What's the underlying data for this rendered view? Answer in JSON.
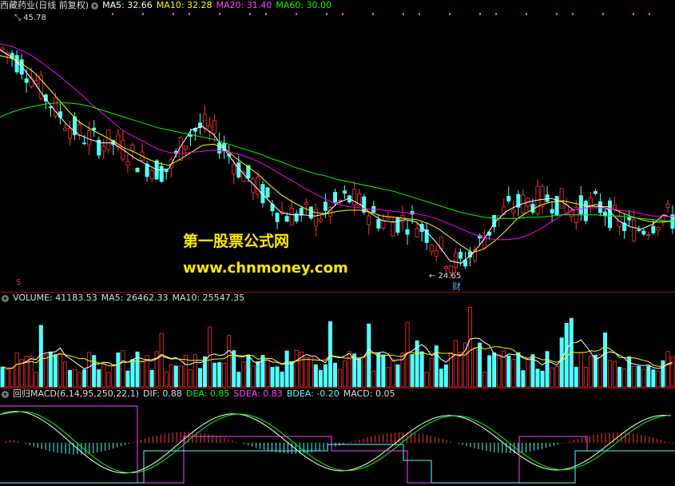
{
  "price_header": {
    "title": "西藏药业(日线 前复权)",
    "ma5": "MA5: 32.66",
    "ma10": "MA10: 32.28",
    "ma20": "MA20: 31.40",
    "ma60": "MA60: 30.00"
  },
  "annotations": {
    "high": "45.78",
    "low": "24.65",
    "cai_marker": "财",
    "s_marker": "S"
  },
  "watermark": {
    "line1": "第一股票公式网",
    "line2": "www.chnmoney.com"
  },
  "volume_header": {
    "volume": "VOLUME: 41183.53",
    "ma5": "MA5: 26462.33",
    "ma10": "MA10: 25547.35"
  },
  "macd_header": {
    "name": "回归MACD(6,14,95,250,22,1)",
    "dif": "DIF: 0.88",
    "dea": "DEA: 0.85",
    "sdea": "SDEA: 0.83",
    "bdea": "BDEA: -0.20",
    "macd": "MACD: 0.05"
  },
  "colors": {
    "up": "#ff3232",
    "down": "#54ffff",
    "ma5": "#ffffff",
    "ma10": "#ffff00",
    "ma20": "#ff00ff",
    "ma60": "#00ff00",
    "background": "#000000"
  },
  "chart_data": {
    "type": "line",
    "ylim": [
      24.0,
      46.5
    ],
    "series": [
      {
        "name": "MA5",
        "values": [
          43.5,
          42.9,
          42.0,
          40.8,
          39.4,
          38.2,
          37.1,
          36.3,
          35.9,
          35.6,
          35.6,
          35.0,
          34.3,
          33.8,
          33.3,
          33.4,
          35.2,
          36.7,
          37.0,
          36.3,
          35.0,
          33.7,
          32.6,
          31.6,
          30.6,
          29.7,
          29.5,
          29.5,
          29.4,
          29.6,
          30.5,
          30.9,
          30.4,
          29.6,
          29.0,
          28.9,
          29.1,
          28.9,
          28.0,
          26.9,
          25.6,
          25.4,
          26.2,
          27.4,
          28.9,
          29.8,
          30.3,
          30.6,
          30.8,
          30.9,
          30.6,
          29.9,
          30.1,
          30.4,
          30.0,
          29.0,
          28.5,
          28.3,
          28.7,
          29.5,
          29.2
        ]
      },
      {
        "name": "MA10",
        "values": [
          43.0,
          42.8,
          42.3,
          41.6,
          40.6,
          39.5,
          38.4,
          37.4,
          36.8,
          36.3,
          35.8,
          35.2,
          34.8,
          34.3,
          33.9,
          33.7,
          34.2,
          34.8,
          35.4,
          35.5,
          35.1,
          34.3,
          33.6,
          32.9,
          32.0,
          31.2,
          30.6,
          30.1,
          29.7,
          29.6,
          29.8,
          29.9,
          29.9,
          29.7,
          29.4,
          29.3,
          29.2,
          29.1,
          28.8,
          28.3,
          27.6,
          26.9,
          26.3,
          26.6,
          27.3,
          28.2,
          29.2,
          29.8,
          30.3,
          30.6,
          30.7,
          30.5,
          30.3,
          30.2,
          30.2,
          29.8,
          29.4,
          29.1,
          28.9,
          28.9,
          29.0
        ]
      },
      {
        "name": "MA20",
        "values": [
          44.0,
          43.8,
          43.4,
          42.9,
          42.2,
          41.5,
          40.7,
          39.9,
          39.0,
          38.2,
          37.4,
          36.6,
          36.1,
          35.6,
          35.1,
          34.8,
          34.7,
          34.8,
          34.9,
          35.0,
          34.9,
          34.7,
          34.4,
          34.0,
          33.5,
          32.9,
          32.4,
          31.8,
          31.3,
          30.8,
          30.4,
          30.2,
          30.1,
          30.0,
          29.9,
          29.8,
          29.7,
          29.6,
          29.4,
          29.1,
          28.7,
          28.3,
          27.9,
          27.6,
          27.4,
          27.4,
          27.5,
          27.8,
          28.3,
          28.9,
          29.5,
          29.9,
          30.1,
          30.1,
          30.1,
          29.9,
          29.8,
          29.6,
          29.4,
          29.4,
          29.3
        ]
      },
      {
        "name": "MA60",
        "values": [
          37.8,
          38.2,
          38.5,
          38.7,
          38.9,
          39.0,
          39.0,
          38.9,
          38.7,
          38.4,
          38.1,
          37.8,
          37.5,
          37.2,
          36.9,
          36.7,
          36.5,
          36.3,
          36.1,
          35.9,
          35.6,
          35.3,
          35.0,
          34.7,
          34.3,
          34.0,
          33.6,
          33.3,
          33.0,
          32.8,
          32.5,
          32.3,
          32.1,
          31.9,
          31.7,
          31.5,
          31.2,
          30.9,
          30.6,
          30.3,
          30.0,
          29.7,
          29.5,
          29.3,
          29.2,
          29.2,
          29.2,
          29.3,
          29.3,
          29.4,
          29.5,
          29.5,
          29.5,
          29.5,
          29.4,
          29.4,
          29.3,
          29.2,
          29.1,
          29.0,
          29.0
        ]
      }
    ]
  }
}
